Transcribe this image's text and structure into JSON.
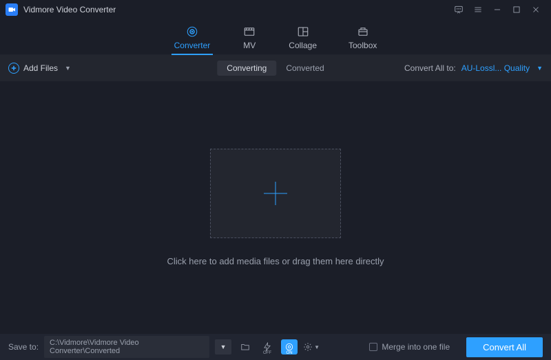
{
  "app_title": "Vidmore Video Converter",
  "tabs": {
    "converter": "Converter",
    "mv": "MV",
    "collage": "Collage",
    "toolbox": "Toolbox"
  },
  "toolbar": {
    "add_files": "Add Files",
    "segments": {
      "converting": "Converting",
      "converted": "Converted"
    },
    "convert_all_label": "Convert All to:",
    "format": "AU-Lossl... Quality"
  },
  "main": {
    "hint": "Click here to add media files or drag them here directly"
  },
  "footer": {
    "save_to_label": "Save to:",
    "path": "C:\\Vidmore\\Vidmore Video Converter\\Converted",
    "merge_label": "Merge into one file",
    "convert_button": "Convert All",
    "gpu_off": "OFF",
    "gpu_on": "ON"
  }
}
